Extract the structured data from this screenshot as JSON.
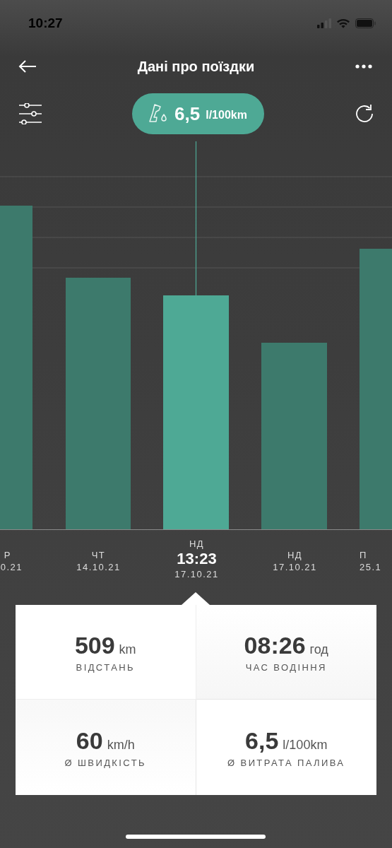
{
  "status_bar": {
    "time": "10:27"
  },
  "header": {
    "title": "Дані про поїздки"
  },
  "summary": {
    "value": "6,5",
    "unit": "l/100km"
  },
  "days": [
    {
      "weekday": "Р",
      "date": "0.21",
      "selected": false
    },
    {
      "weekday": "ЧТ",
      "date": "14.10.21",
      "selected": false
    },
    {
      "weekday": "НД",
      "time": "13:23",
      "date": "17.10.21",
      "selected": true
    },
    {
      "weekday": "НД",
      "date": "17.10.21",
      "selected": false
    },
    {
      "weekday": "П",
      "date": "25.1",
      "selected": false
    }
  ],
  "stats": [
    {
      "value": "509",
      "unit": "km",
      "label": "ВІДСТАНЬ"
    },
    {
      "value": "08:26",
      "unit": "год",
      "label": "ЧАС ВОДІННЯ"
    },
    {
      "value": "60",
      "unit": "km/h",
      "label": "Ø ШВИДКІСТЬ"
    },
    {
      "value": "6,5",
      "unit": "l/100km",
      "label": "Ø ВИТРАТА ПАЛИВА"
    }
  ]
}
